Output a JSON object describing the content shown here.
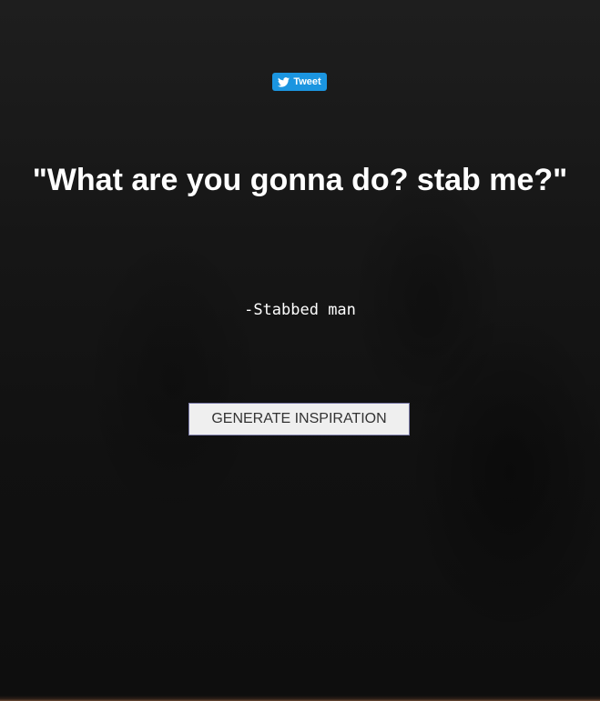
{
  "tweet_button": {
    "label": "Tweet",
    "icon": "twitter-bird-icon",
    "color": "#1b95e0"
  },
  "quote": {
    "text": "\"What are you gonna do? stab me?\""
  },
  "author": {
    "text": "-Stabbed man"
  },
  "generate_button": {
    "label": "GENERATE INSPIRATION"
  },
  "colors": {
    "background": "#141414",
    "text": "#ffffff",
    "button_bg": "#efefef"
  }
}
